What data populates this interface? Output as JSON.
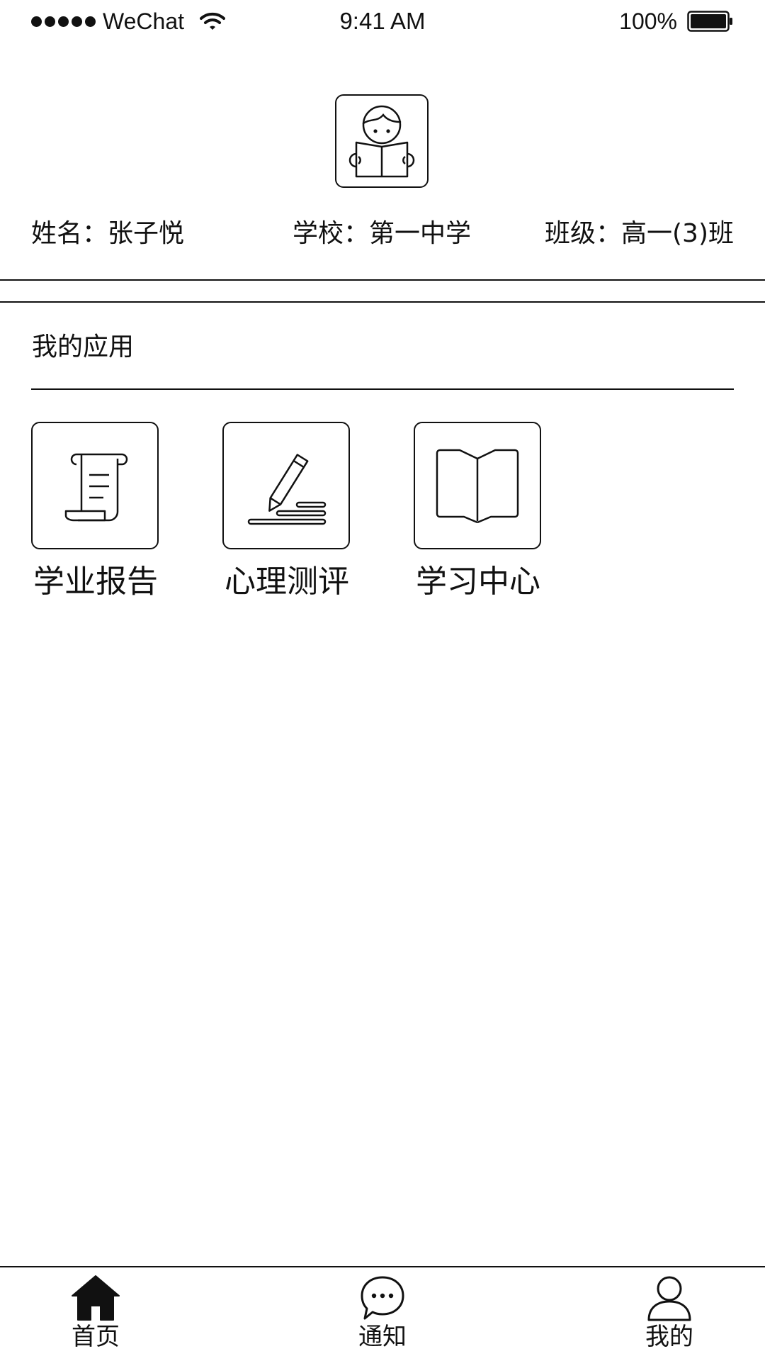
{
  "status_bar": {
    "carrier": "WeChat",
    "time": "9:41 AM",
    "battery": "100%"
  },
  "profile": {
    "avatar_icon": "reading-boy-icon",
    "name": "姓名：张子悦",
    "school": "学校：第一中学",
    "class": "班级：高一(3)班"
  },
  "apps_section": {
    "title": "我的应用",
    "apps": [
      {
        "label": "学业报告",
        "icon": "scroll-report-icon"
      },
      {
        "label": "心理测评",
        "icon": "pencil-assessment-icon"
      },
      {
        "label": "学习中心",
        "icon": "open-book-icon"
      }
    ]
  },
  "tab_bar": {
    "tabs": [
      {
        "label": "首页",
        "icon": "home-icon",
        "active": true
      },
      {
        "label": "通知",
        "icon": "chat-bubble-icon",
        "active": false
      },
      {
        "label": "我的",
        "icon": "user-icon",
        "active": false
      }
    ]
  },
  "colors": {
    "foreground": "#111111",
    "background": "#ffffff"
  }
}
